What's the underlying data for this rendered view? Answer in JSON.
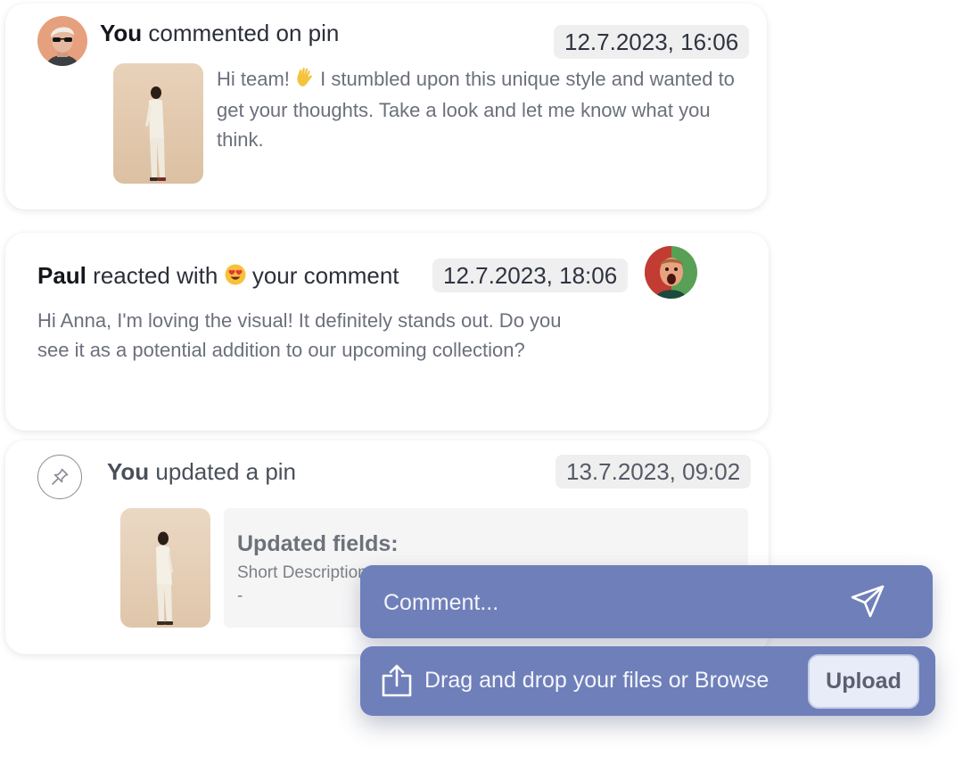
{
  "activity": [
    {
      "actor": "You",
      "action": "commented on pin",
      "date": "12.7.2023, 16:06",
      "emoji": "👋",
      "text_before_emoji": "Hi team!",
      "text_after_emoji": "I stumbled upon this unique style and wanted to get your thoughts. Take a look and let me know what you think."
    },
    {
      "actor": "Paul",
      "action_prefix": "reacted with",
      "reaction_emoji": "😍",
      "action_suffix": "your comment",
      "date": "12.7.2023, 18:06",
      "text": "Hi Anna, I'm loving the visual! It definitely stands out. Do you see it as a potential addition to our upcoming collection?"
    },
    {
      "actor": "You",
      "action": "updated a pin",
      "date": "13.7.2023, 09:02",
      "fields_title": "Updated fields:",
      "field_name": "Short Description",
      "field_value": "-"
    }
  ],
  "composer": {
    "comment_placeholder": "Comment...",
    "upload_prompt": "Drag and drop your files or Browse",
    "upload_button": "Upload",
    "accent_color": "#6f7fb9"
  },
  "icons": [
    "avatar-you",
    "avatar-paul",
    "pin-icon",
    "send-icon",
    "upload-icon"
  ]
}
